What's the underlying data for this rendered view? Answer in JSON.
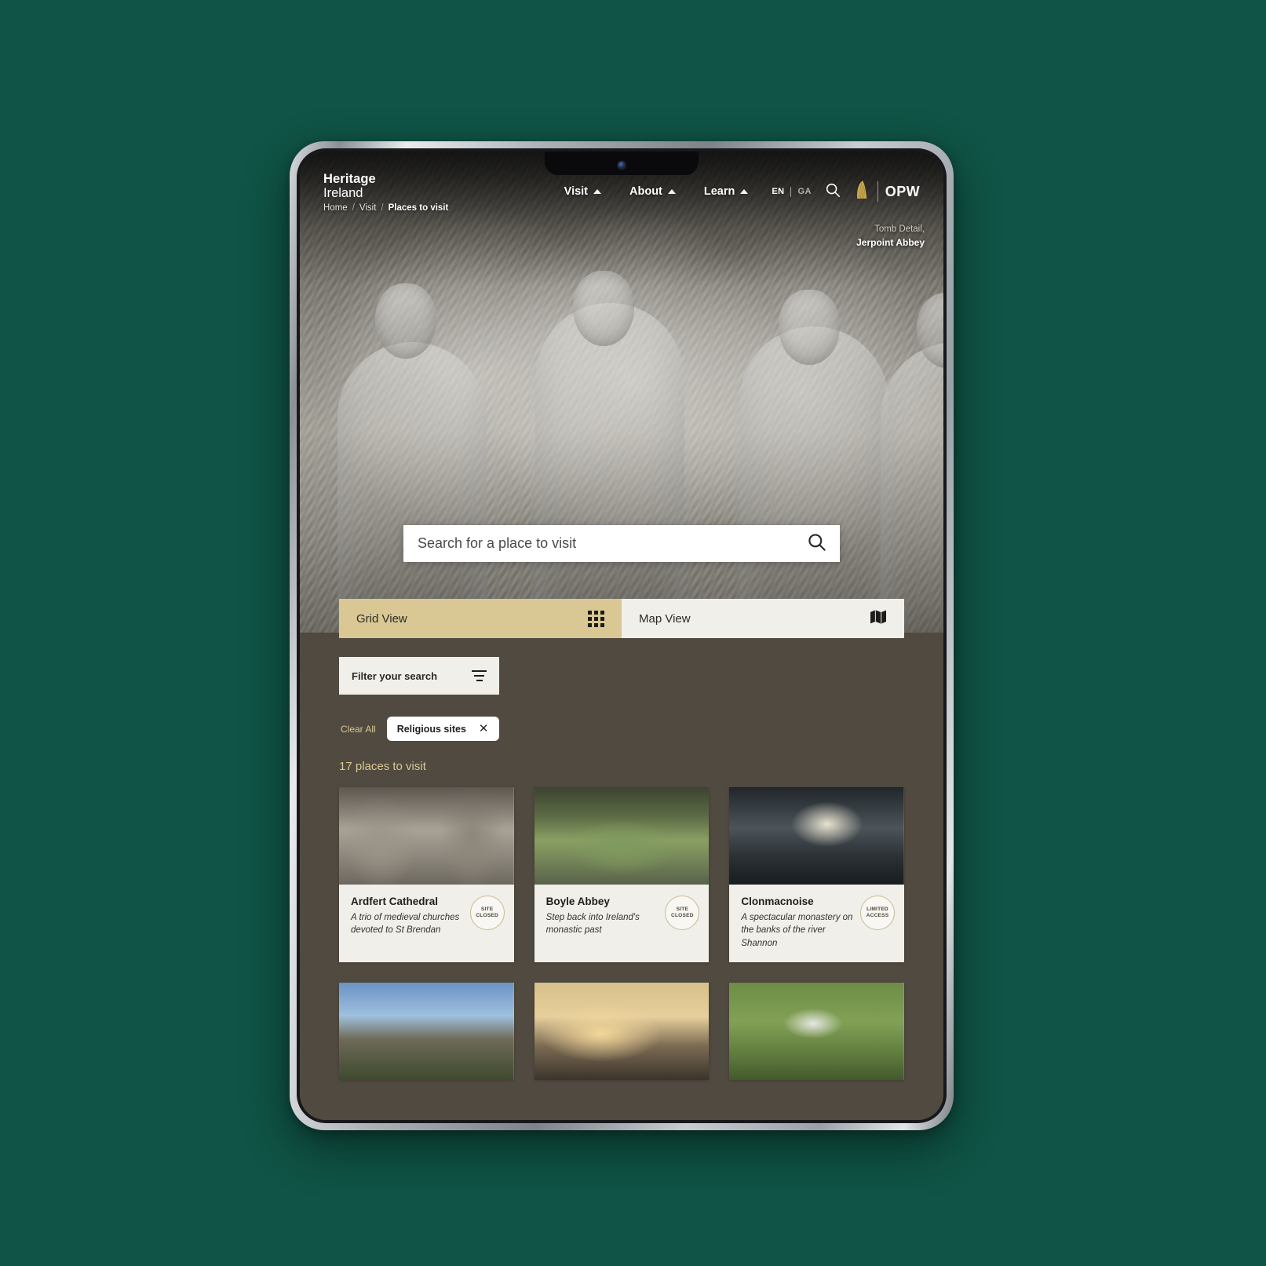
{
  "site": {
    "brand_line1": "Heritage",
    "brand_line2": "Ireland",
    "opw_label": "OPW"
  },
  "nav": {
    "items": [
      {
        "label": "Visit",
        "icon": "caret-up-icon"
      },
      {
        "label": "About",
        "icon": "caret-up-icon"
      },
      {
        "label": "Learn",
        "icon": "caret-up-icon"
      }
    ],
    "lang_active": "EN",
    "lang_inactive": "GA",
    "search_icon": "search-icon",
    "harp_icon": "harp-icon"
  },
  "breadcrumb": {
    "items": [
      "Home",
      "Visit",
      "Places to visit"
    ],
    "separator": "/"
  },
  "hero": {
    "caption_line1": "Tomb Detail,",
    "caption_line2": "Jerpoint Abbey"
  },
  "search": {
    "placeholder": "Search for a place to visit",
    "value": "",
    "icon": "search-icon"
  },
  "view_tabs": [
    {
      "label": "Grid View",
      "icon": "grid-icon",
      "active": true
    },
    {
      "label": "Map View",
      "icon": "map-icon",
      "active": false
    }
  ],
  "filter": {
    "label": "Filter your search",
    "icon": "filter-icon"
  },
  "active_filters": {
    "clear_all_label": "Clear All",
    "chips": [
      {
        "label": "Religious sites",
        "remove_icon": "close-icon"
      }
    ]
  },
  "results": {
    "count_label": "17 places to visit",
    "cards": [
      {
        "title": "Ardfert Cathedral",
        "description": "A trio of medieval churches devoted to St Brendan",
        "badge_line1": "SITE",
        "badge_line2": "CLOSED",
        "thumb_class": "t-ardfert"
      },
      {
        "title": "Boyle Abbey",
        "description": "Step back into Ireland's monastic past",
        "badge_line1": "SITE",
        "badge_line2": "CLOSED",
        "thumb_class": "t-boyle"
      },
      {
        "title": "Clonmacnoise",
        "description": "A spectacular monastery on the banks of the river Shannon",
        "badge_line1": "LIMITED",
        "badge_line2": "ACCESS",
        "thumb_class": "t-clon"
      },
      {
        "title": "",
        "description": "",
        "badge_line1": "",
        "badge_line2": "",
        "thumb_class": "t-round"
      },
      {
        "title": "",
        "description": "",
        "badge_line1": "",
        "badge_line2": "",
        "thumb_class": "t-cashel"
      },
      {
        "title": "",
        "description": "",
        "badge_line1": "",
        "badge_line2": "",
        "thumb_class": "t-aerial"
      }
    ]
  },
  "colors": {
    "page_background": "#0f5446",
    "accent_gold": "#d9c894",
    "results_background": "#514a40",
    "card_background": "#f1efe9"
  }
}
